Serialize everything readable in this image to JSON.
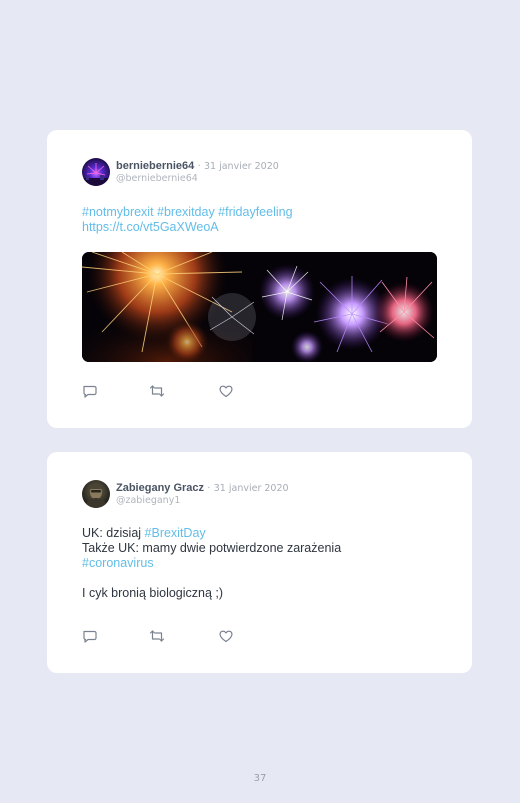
{
  "tweets": [
    {
      "author_name": "berniebernie64",
      "separator": "·",
      "date": "31 janvier 2020",
      "handle": "@berniebernie64",
      "avatar_icon": "fireworks-avatar-icon",
      "lines": [
        [
          {
            "text": "#notmybrexit #brexitday #fridayfeeling",
            "link": true
          }
        ],
        [
          {
            "text": "https://t.co/vt5GaXWeoA",
            "link": true
          }
        ]
      ],
      "media_icon": "fireworks-photo",
      "actions": {
        "reply": "reply-icon",
        "retweet": "retweet-icon",
        "like": "heart-icon"
      }
    },
    {
      "author_name": "Zabiegany Gracz",
      "separator": "·",
      "date": "31 janvier 2020",
      "handle": "@zabiegany1",
      "avatar_icon": "portrait-avatar-icon",
      "lines": [
        [
          {
            "text": "UK: dzisiaj ",
            "link": false
          },
          {
            "text": "#BrexitDay",
            "link": true
          }
        ],
        [
          {
            "text": "Także UK: mamy dwie potwierdzone zarażenia",
            "link": false
          }
        ],
        [
          {
            "text": "#coronavirus",
            "link": true
          }
        ],
        [
          {
            "text": "",
            "link": false
          }
        ],
        [
          {
            "text": "I cyk bronią biologiczną ;)",
            "link": false
          }
        ]
      ],
      "actions": {
        "reply": "reply-icon",
        "retweet": "retweet-icon",
        "like": "heart-icon"
      }
    }
  ],
  "colors": {
    "background": "#e6e8f4",
    "card": "#ffffff",
    "link": "#62bde8",
    "text": "#2f3640",
    "meta": "#a7adb6"
  },
  "page_number": "37"
}
